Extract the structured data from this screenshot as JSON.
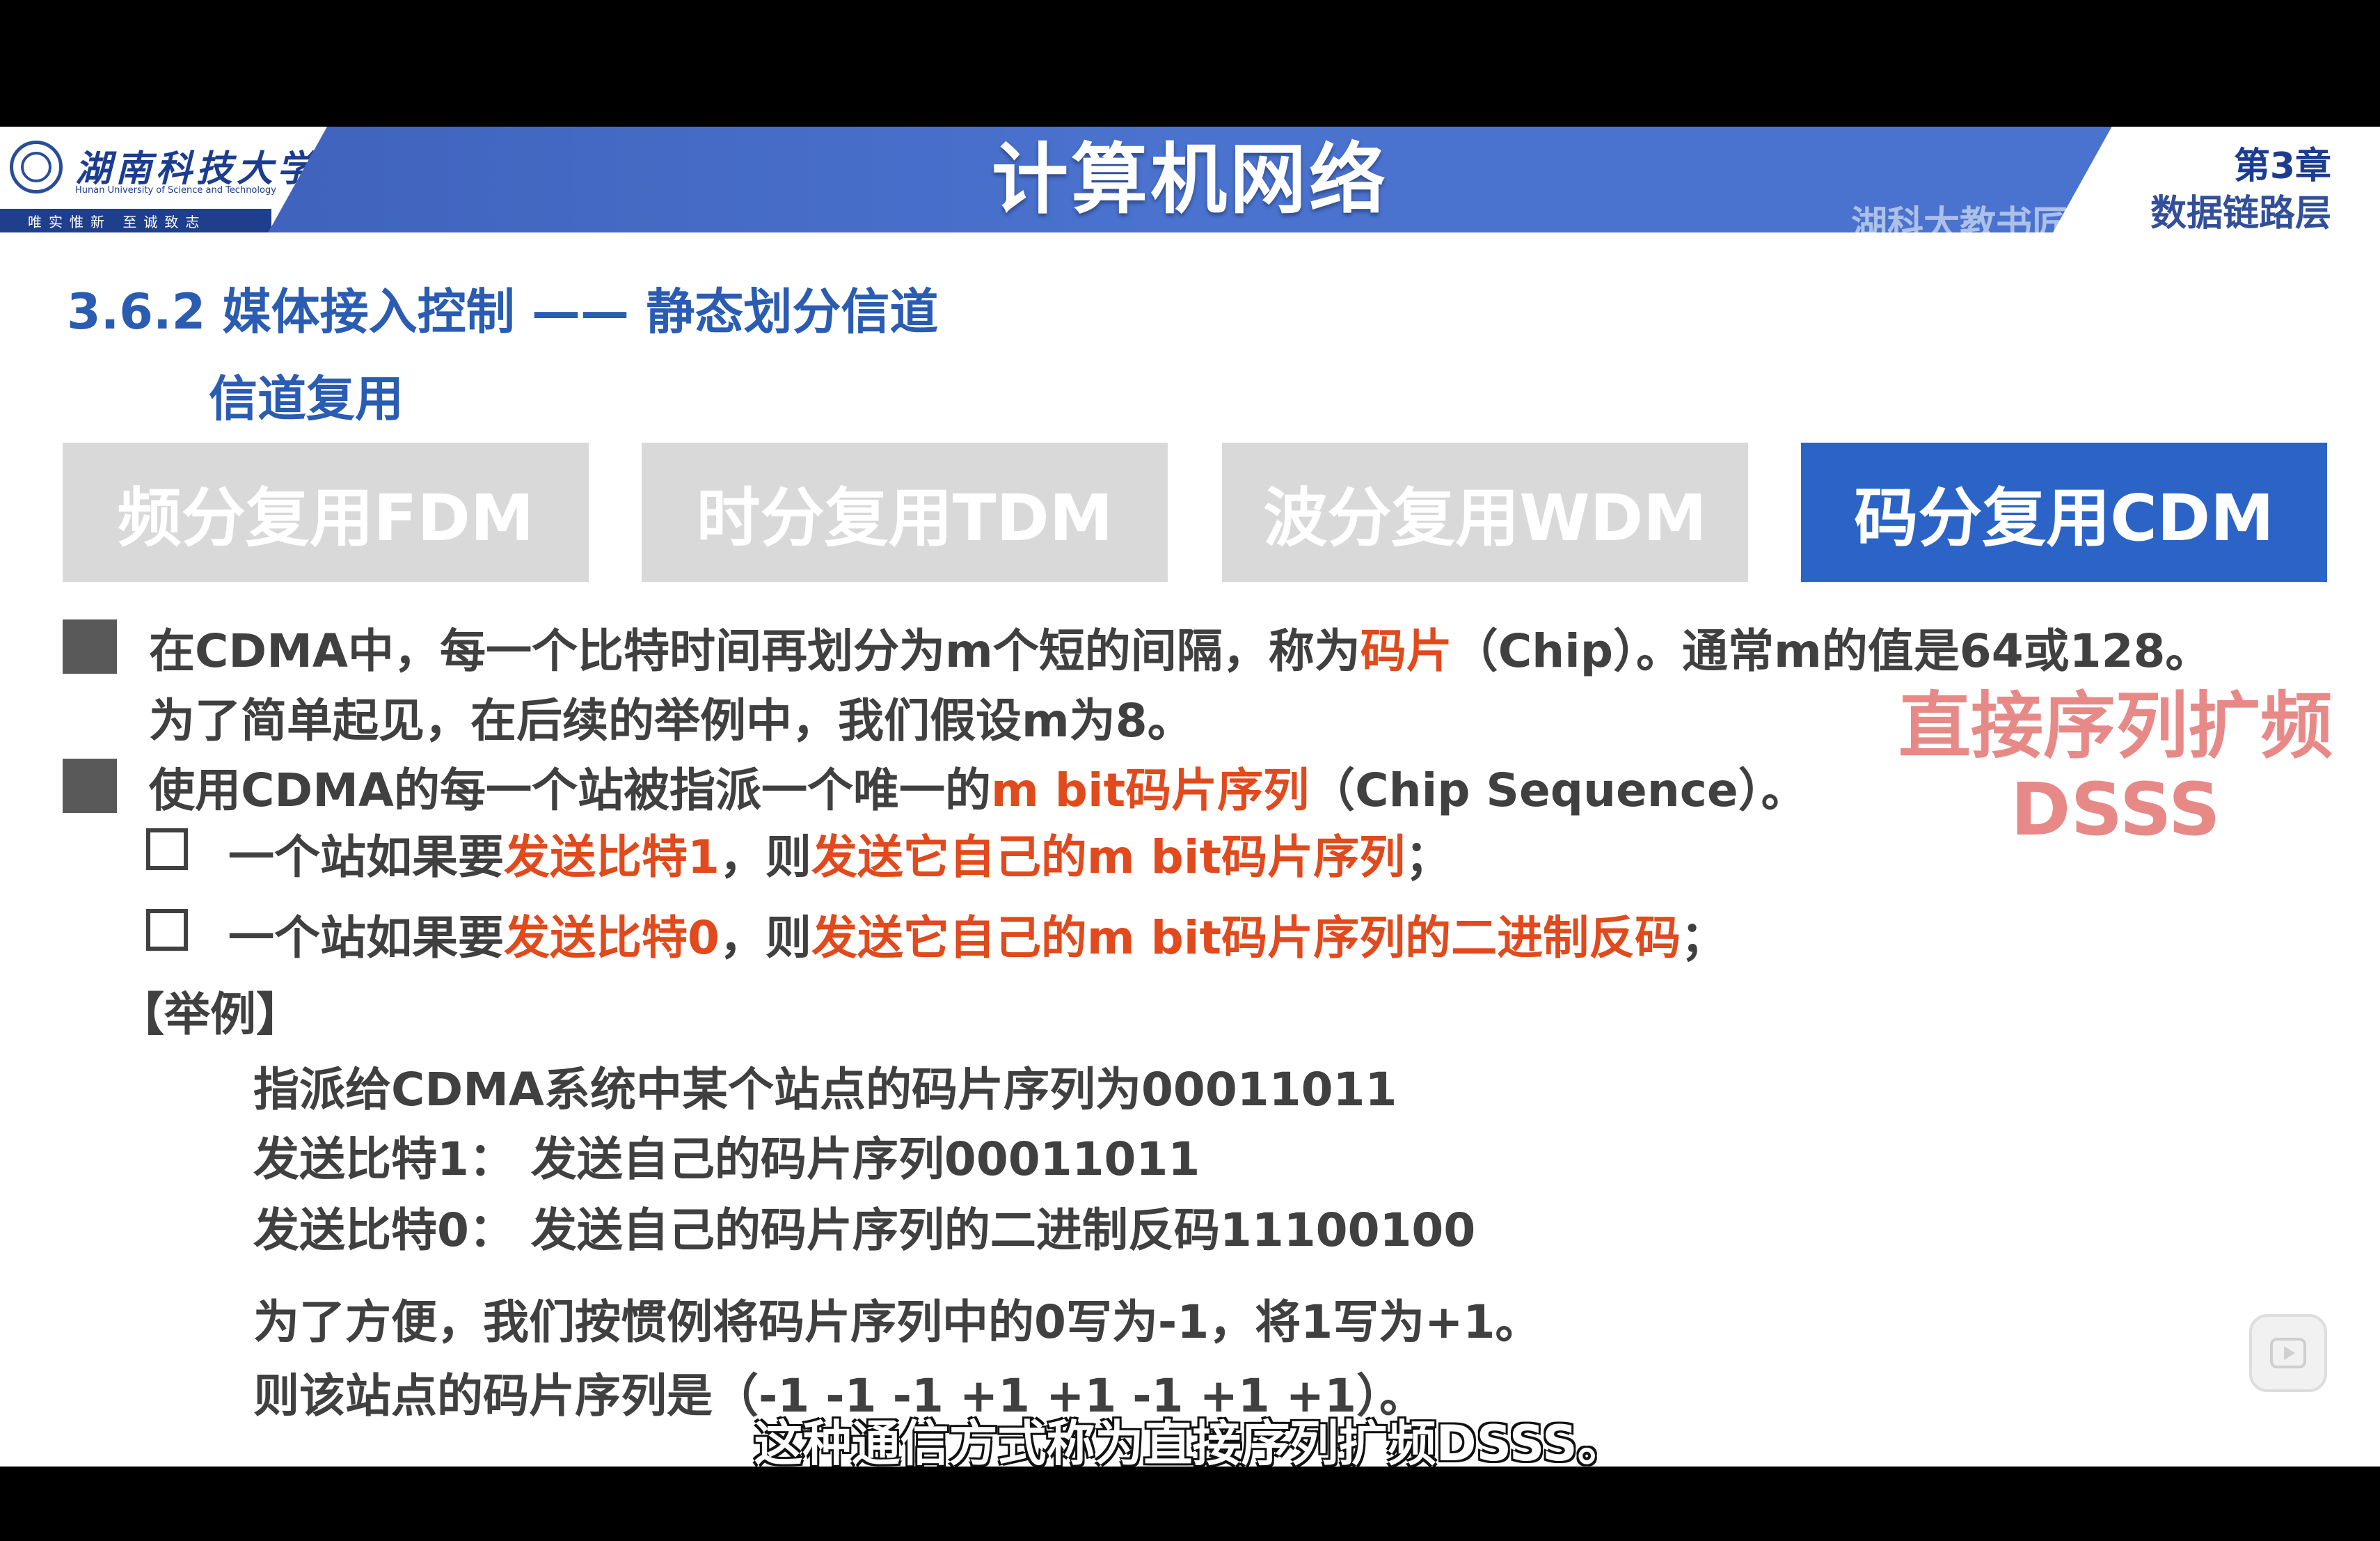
{
  "header": {
    "university_logo_text": "湖南科技大学",
    "university_en": "Hunan University of Science and Technology",
    "motto": "唯实惟新  至诚致志",
    "title": "计算机网络",
    "chapter": "第3章",
    "chapter_title": "数据链路层",
    "watermark": "湖科大教书匠"
  },
  "section": {
    "heading": "3.6.2 媒体接入控制 —— 静态划分信道",
    "subheading": "信道复用"
  },
  "tabs": [
    {
      "label": "频分复用FDM",
      "active": false
    },
    {
      "label": "时分复用TDM",
      "active": false
    },
    {
      "label": "波分复用WDM",
      "active": false
    },
    {
      "label": "码分复用CDM",
      "active": true
    }
  ],
  "bullets": {
    "b1_a": "在CDMA中，每一个比特时间再划分为m个短的间隔，称为",
    "b1_red": "码片",
    "b1_b": "（Chip）。通常m的值是64或128。",
    "b1_line2": "为了简单起见，在后续的举例中，我们假设m为8。",
    "b2_a": "使用CDMA的每一个站被指派一个唯一的",
    "b2_red": "m bit码片序列",
    "b2_b": "（Chip Sequence）。",
    "c1_a": "一个站如果要",
    "c1_red1": "发送比特1",
    "c1_b": "，则",
    "c1_red2": "发送它自己的m bit码片序列",
    "c1_c": "；",
    "c2_a": "一个站如果要",
    "c2_red1": "发送比特0",
    "c2_b": "，则",
    "c2_red2": "发送它自己的m bit码片序列的二进制反码",
    "c2_c": "；"
  },
  "example": {
    "label": "【举例】",
    "line1": "指派给CDMA系统中某个站点的码片序列为00011011",
    "line2": "发送比特1：   发送自己的码片序列00011011",
    "line3": "发送比特0：   发送自己的码片序列的二进制反码11100100",
    "line4": "为了方便，我们按惯例将码片序列中的0写为-1，将1写为+1。",
    "line5": "则该站点的码片序列是（-1 -1 -1 +1 +1 -1 +1 +1）。"
  },
  "annotation": {
    "line1": "直接序列扩频",
    "line2": "DSSS"
  },
  "subtitle": "这种通信方式称为直接序列扩频DSSS。",
  "colors": {
    "accent_blue": "#2b64c6",
    "highlight_red": "#e04a1d",
    "annotation_pink": "#e78a87"
  },
  "icons": {
    "play": "play-icon"
  }
}
